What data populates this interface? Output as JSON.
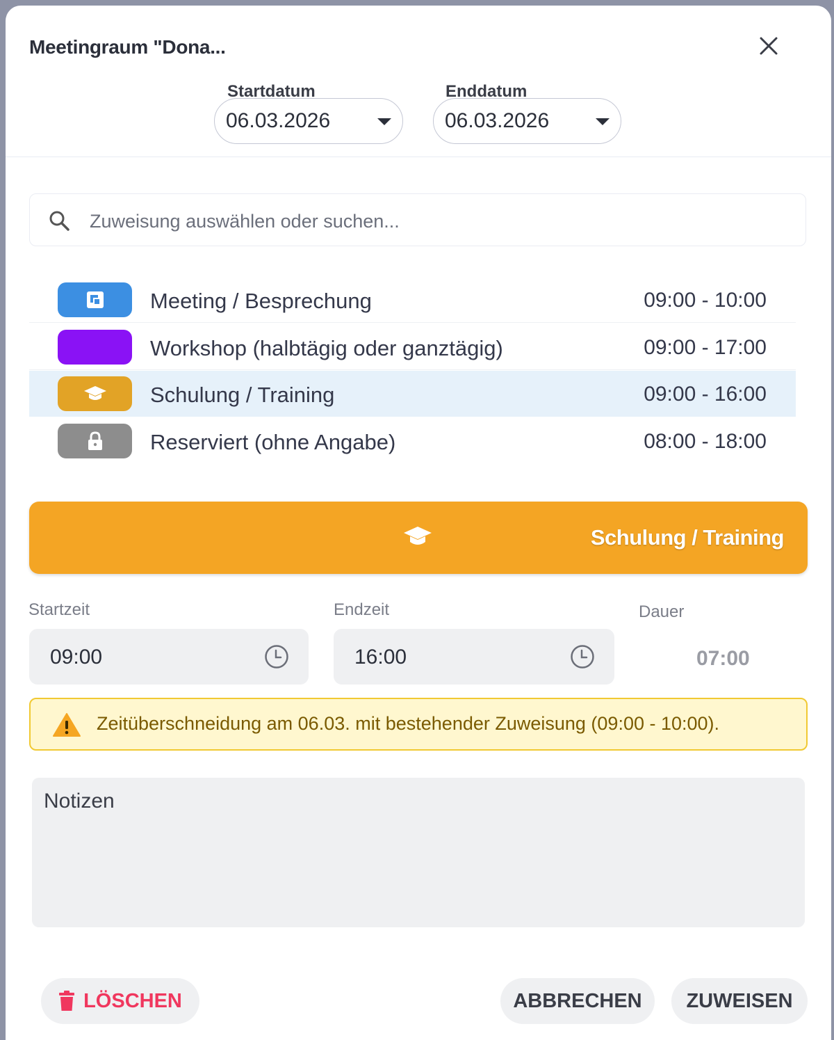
{
  "dialog": {
    "title": "Meetingraum \"Dona..."
  },
  "dates": {
    "start_label": "Startdatum",
    "start_value": "06.03.2026",
    "end_label": "Enddatum",
    "end_value": "06.03.2026"
  },
  "search": {
    "placeholder": "Zuweisung auswählen oder suchen..."
  },
  "assignments": [
    {
      "label": "Meeting / Besprechung",
      "time": "09:00 - 10:00",
      "color": "#3c8fe2",
      "icon": "meeting-icon",
      "selected": false
    },
    {
      "label": "Workshop (halbtägig oder ganztägig)",
      "time": "09:00 - 17:00",
      "color": "#8a12f5",
      "icon": "none",
      "selected": false
    },
    {
      "label": "Schulung / Training",
      "time": "09:00 - 16:00",
      "color": "#e2a326",
      "icon": "graduation-cap-icon",
      "selected": true
    },
    {
      "label": "Reserviert (ohne Angabe)",
      "time": "08:00 - 18:00",
      "color": "#8d8d8d",
      "icon": "lock-icon",
      "selected": false
    }
  ],
  "selected_banner": {
    "label": "Schulung / Training",
    "color": "#f4a524",
    "icon": "graduation-cap-icon"
  },
  "times": {
    "start_label": "Startzeit",
    "start_value": "09:00",
    "end_label": "Endzeit",
    "end_value": "16:00",
    "duration_label": "Dauer",
    "duration_value": "07:00"
  },
  "warning": {
    "text": "Zeitüberschneidung am 06.03. mit bestehender Zuweisung (09:00 - 10:00)."
  },
  "notes": {
    "placeholder": "Notizen"
  },
  "buttons": {
    "delete": "LÖSCHEN",
    "cancel": "ABBRECHEN",
    "assign": "ZUWEISEN"
  },
  "colors": {
    "delete": "#f0375e",
    "accent": "#f4a524",
    "warning_border": "#f1c932"
  }
}
